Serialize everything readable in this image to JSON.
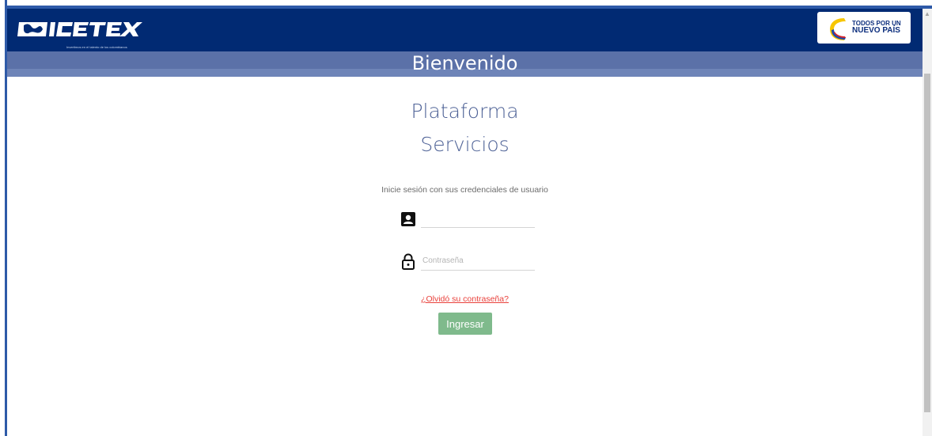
{
  "header": {
    "logo_text": "ICETEX",
    "logo_tagline": "Invertimos en el talento de los colombianos",
    "gov_badge": {
      "line1": "TODOS POR UN",
      "line2": "NUEVO PAÍS"
    }
  },
  "welcome": {
    "text": "Bienvenido"
  },
  "main": {
    "title_line1": "Plataforma",
    "title_line2": "Servicios",
    "prompt": "Inicie sesión con sus credenciales de usuario",
    "username": {
      "value": "",
      "icon": "user-card-icon"
    },
    "password": {
      "placeholder": "Contraseña",
      "icon": "lock-icon"
    },
    "forgot_link": "¿Olvidó su contraseña?",
    "login_button": "Ingresar"
  },
  "colors": {
    "header_bg": "#012a73",
    "band_bg": "#5b71a8",
    "title_color": "#4f6397",
    "link_color": "#e9413b",
    "button_bg": "#7fba8c"
  }
}
